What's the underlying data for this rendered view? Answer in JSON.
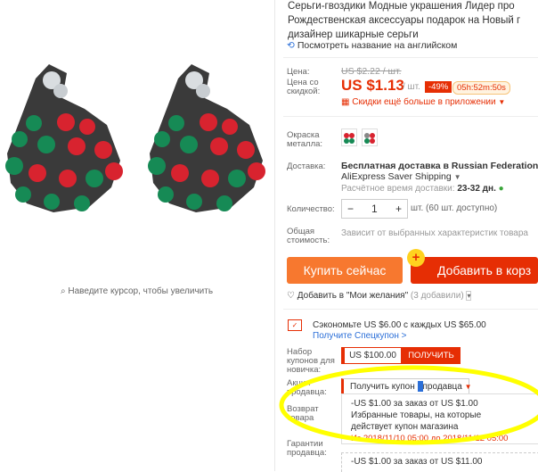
{
  "gallery": {
    "zoom_hint": "Наведите курсор, чтобы увеличить"
  },
  "product": {
    "title_lines": [
      "Серьги-гвоздики Модные украшения Лидер про",
      "Рождественская аксессуары подарок на Новый г",
      "дизайнер шикарные серьги"
    ],
    "translate_link": "Посмотреть название на английском"
  },
  "price": {
    "label": "Цена:",
    "old": "US $2.22 / шт.",
    "discount_label_1": "Цена со",
    "discount_label_2": "скидкой:",
    "current": "US $1.13",
    "unit": "/ шт.",
    "discount_badge": "-49%",
    "timer": "05h:52m:50s",
    "app_deal": "Скидки ещё больше в приложении"
  },
  "color": {
    "label_1": "Окраска",
    "label_2": "металла:"
  },
  "shipping": {
    "label": "Доставка:",
    "line1": "Бесплатная доставка в Russian Federation",
    "line2": "AliExpress Saver Shipping",
    "eta_label": "Расчётное время доставки:",
    "eta_value": "23-32 дн."
  },
  "quantity": {
    "label": "Количество:",
    "minus": "−",
    "value": "1",
    "plus": "+",
    "unit": "шт. (60 шт. доступно)"
  },
  "total": {
    "label_1": "Общая",
    "label_2": "стоимость:",
    "value": "Зависит от выбранных характеристик товара"
  },
  "actions": {
    "buy_now": "Купить сейчас",
    "add_to_cart": "Добавить в корз",
    "cart_badge": "+",
    "wishlist": "Добавить в \"Мои желания\"",
    "wishlist_count": "(3 добавили)"
  },
  "promo": {
    "save": "Сэкономьте US $6.00 с каждых US $65.00",
    "get_coupon_link": "Получите Спецкупон >",
    "new_user_label_1": "Набор",
    "new_user_label_2": "купонов для",
    "new_user_label_3": "новичка:",
    "new_user_amount": "US $100.00",
    "new_user_button": "ПОЛУЧИТЬ",
    "seller_label_1": "Акция",
    "seller_label_2": "продавца:",
    "seller_dropdown_a": "Получить купон ",
    "seller_dropdown_b": "продавца",
    "coupon1_line1": "-US $1.00 за заказ от US $1.00",
    "coupon1_line2": "Избранные товары, на которые",
    "coupon1_line3": "действует купон магазина",
    "coupon1_dates": "Из 2018/11/10 05:00 до 2018/11/12 05:00",
    "return_label_1": "Возврат",
    "return_label_2": "товара",
    "guarantee_label_1": "Гарантии",
    "guarantee_label_2": "продавца:",
    "coupon2_line1": "-US $1.00 за заказ от US $11.00"
  },
  "colors": {
    "accent": "#e62e04",
    "buy_orange": "#f7782f",
    "link_blue": "#2b6fd8",
    "highlight": "#ffff00"
  }
}
